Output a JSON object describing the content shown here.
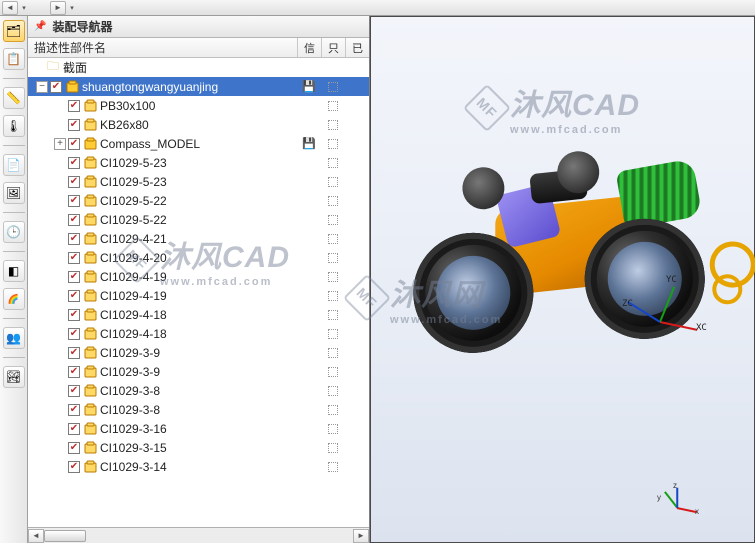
{
  "navigator": {
    "title": "装配导航器",
    "columns": {
      "name": "描述性部件名",
      "info": "信",
      "ro": "只",
      "loaded": "已"
    }
  },
  "tree": {
    "root_section": "截面",
    "items": [
      {
        "label": "shuangtongwangyuanjing",
        "depth": 0,
        "exp": "-",
        "selected": true,
        "assy": true,
        "save": true
      },
      {
        "label": "PB30x100",
        "depth": 1
      },
      {
        "label": "KB26x80",
        "depth": 1
      },
      {
        "label": "Compass_MODEL",
        "depth": 1,
        "exp": "+",
        "assy": true,
        "save": true
      },
      {
        "label": "CI1029-5-23",
        "depth": 1
      },
      {
        "label": "CI1029-5-23",
        "depth": 1
      },
      {
        "label": "CI1029-5-22",
        "depth": 1
      },
      {
        "label": "CI1029-5-22",
        "depth": 1
      },
      {
        "label": "CI1029-4-21",
        "depth": 1
      },
      {
        "label": "CI1029-4-20",
        "depth": 1
      },
      {
        "label": "CI1029-4-19",
        "depth": 1
      },
      {
        "label": "CI1029-4-19",
        "depth": 1
      },
      {
        "label": "CI1029-4-18",
        "depth": 1
      },
      {
        "label": "CI1029-4-18",
        "depth": 1
      },
      {
        "label": "CI1029-3-9",
        "depth": 1
      },
      {
        "label": "CI1029-3-9",
        "depth": 1
      },
      {
        "label": "CI1029-3-8",
        "depth": 1
      },
      {
        "label": "CI1029-3-8",
        "depth": 1
      },
      {
        "label": "CI1029-3-16",
        "depth": 1
      },
      {
        "label": "CI1029-3-15",
        "depth": 1
      },
      {
        "label": "CI1029-3-14",
        "depth": 1
      }
    ]
  },
  "triad": {
    "x": "XC",
    "y": "YC",
    "z": "ZC",
    "sx": "x",
    "sy": "y",
    "sz": "z"
  },
  "watermark": {
    "brand": "沐风CAD",
    "brand2": "沐风网",
    "url": "www.mfcad.com",
    "logo": "MF"
  },
  "toolbar_icons": [
    "tree",
    "layers",
    "measure",
    "thermo",
    "sheet",
    "render",
    "clock",
    "shade",
    "color",
    "people",
    "image"
  ]
}
